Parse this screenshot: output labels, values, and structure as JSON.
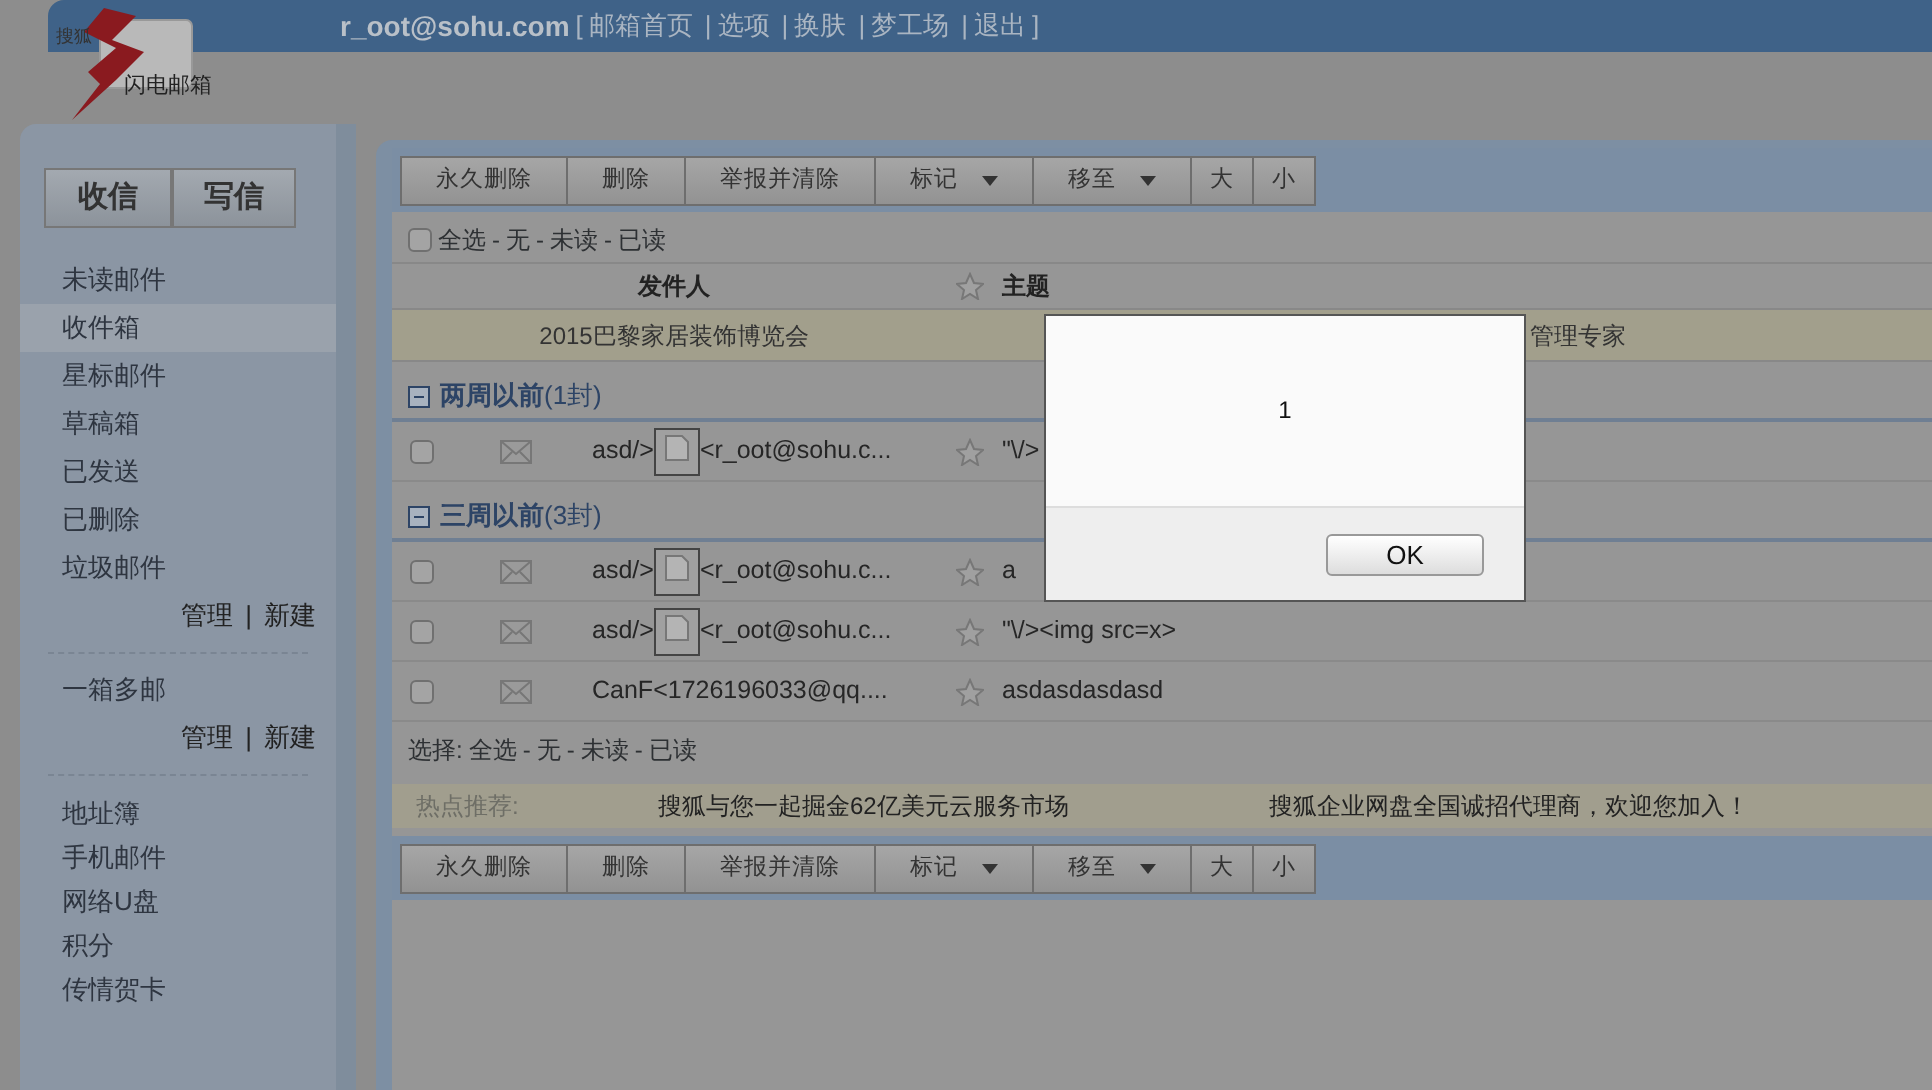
{
  "logo": {
    "top_text": "搜狐",
    "main_text": "闪电邮箱"
  },
  "header": {
    "email": "r_oot@sohu.com",
    "open_bracket": "[",
    "close_bracket": "]",
    "separator": "|",
    "links": [
      "邮箱首页",
      "选项",
      "换肤",
      "梦工场",
      "退出"
    ]
  },
  "sidebar": {
    "buttons": [
      "收信",
      "写信"
    ],
    "folders": [
      {
        "label": "未读邮件",
        "selected": false
      },
      {
        "label": "收件箱",
        "selected": true
      },
      {
        "label": "星标邮件",
        "selected": false
      },
      {
        "label": "草稿箱",
        "selected": false
      },
      {
        "label": "已发送",
        "selected": false
      },
      {
        "label": "已删除",
        "selected": false
      },
      {
        "label": "垃圾邮件",
        "selected": false
      }
    ],
    "folder_links": [
      "管理",
      "新建"
    ],
    "link_separator": "|",
    "multi": "一箱多邮",
    "multi_links": [
      "管理",
      "新建"
    ],
    "tools": [
      "地址簿",
      "手机邮件",
      "网络U盘",
      "积分",
      "传情贺卡"
    ]
  },
  "toolbar_top": [
    {
      "label": "永久删除",
      "kind": "button"
    },
    {
      "label": "删除",
      "kind": "button"
    },
    {
      "label": "举报并清除",
      "kind": "button"
    },
    {
      "label": "标记",
      "kind": "dropdown"
    },
    {
      "label": "移至",
      "kind": "dropdown"
    },
    {
      "label": "大",
      "kind": "button"
    },
    {
      "label": "小",
      "kind": "button"
    }
  ],
  "select_top": {
    "checked": false,
    "separator": "-",
    "links": [
      "全选",
      "无",
      "未读",
      "已读"
    ]
  },
  "columns": [
    "发件人",
    "主题"
  ],
  "ad_row": {
    "left": "2015巴黎家居装饰博览会",
    "right": "管理专家"
  },
  "groups": [
    {
      "title": "两周以前",
      "count": "(1封)",
      "expanded": true,
      "rows": [
        {
          "checked": false,
          "sender_prefix": "asd/>",
          "broken_image": true,
          "sender": "<r_oot@sohu.c...",
          "subject": "\"\\/>"
        }
      ]
    },
    {
      "title": "三周以前",
      "count": "(3封)",
      "expanded": true,
      "rows": [
        {
          "checked": false,
          "sender_prefix": "asd/>",
          "broken_image": true,
          "sender": "<r_oot@sohu.c...",
          "subject": "a"
        },
        {
          "checked": false,
          "sender_prefix": "asd/>",
          "broken_image": true,
          "sender": "<r_oot@sohu.c...",
          "subject": "\"\\/><img src=x>"
        },
        {
          "checked": false,
          "sender_prefix": "",
          "broken_image": false,
          "sender": "CanF<1726196033@qq....",
          "subject": "asdasdasdasd"
        }
      ]
    }
  ],
  "select_bottom": {
    "prefix": "选择:",
    "separator": "-",
    "links": [
      "全选",
      "无",
      "未读",
      "已读"
    ]
  },
  "hot": {
    "label": "热点推荐:",
    "links": [
      "搜狐与您一起掘金62亿美元云服务市场",
      "搜狐企业网盘全国诚招代理商，欢迎您加入！"
    ]
  },
  "toolbar_bottom": [
    {
      "label": "永久删除",
      "kind": "button"
    },
    {
      "label": "删除",
      "kind": "button"
    },
    {
      "label": "举报并清除",
      "kind": "button"
    },
    {
      "label": "标记",
      "kind": "dropdown"
    },
    {
      "label": "移至",
      "kind": "dropdown"
    },
    {
      "label": "大",
      "kind": "button"
    },
    {
      "label": "小",
      "kind": "button"
    }
  ],
  "dialog": {
    "message": "1",
    "button": "OK"
  }
}
